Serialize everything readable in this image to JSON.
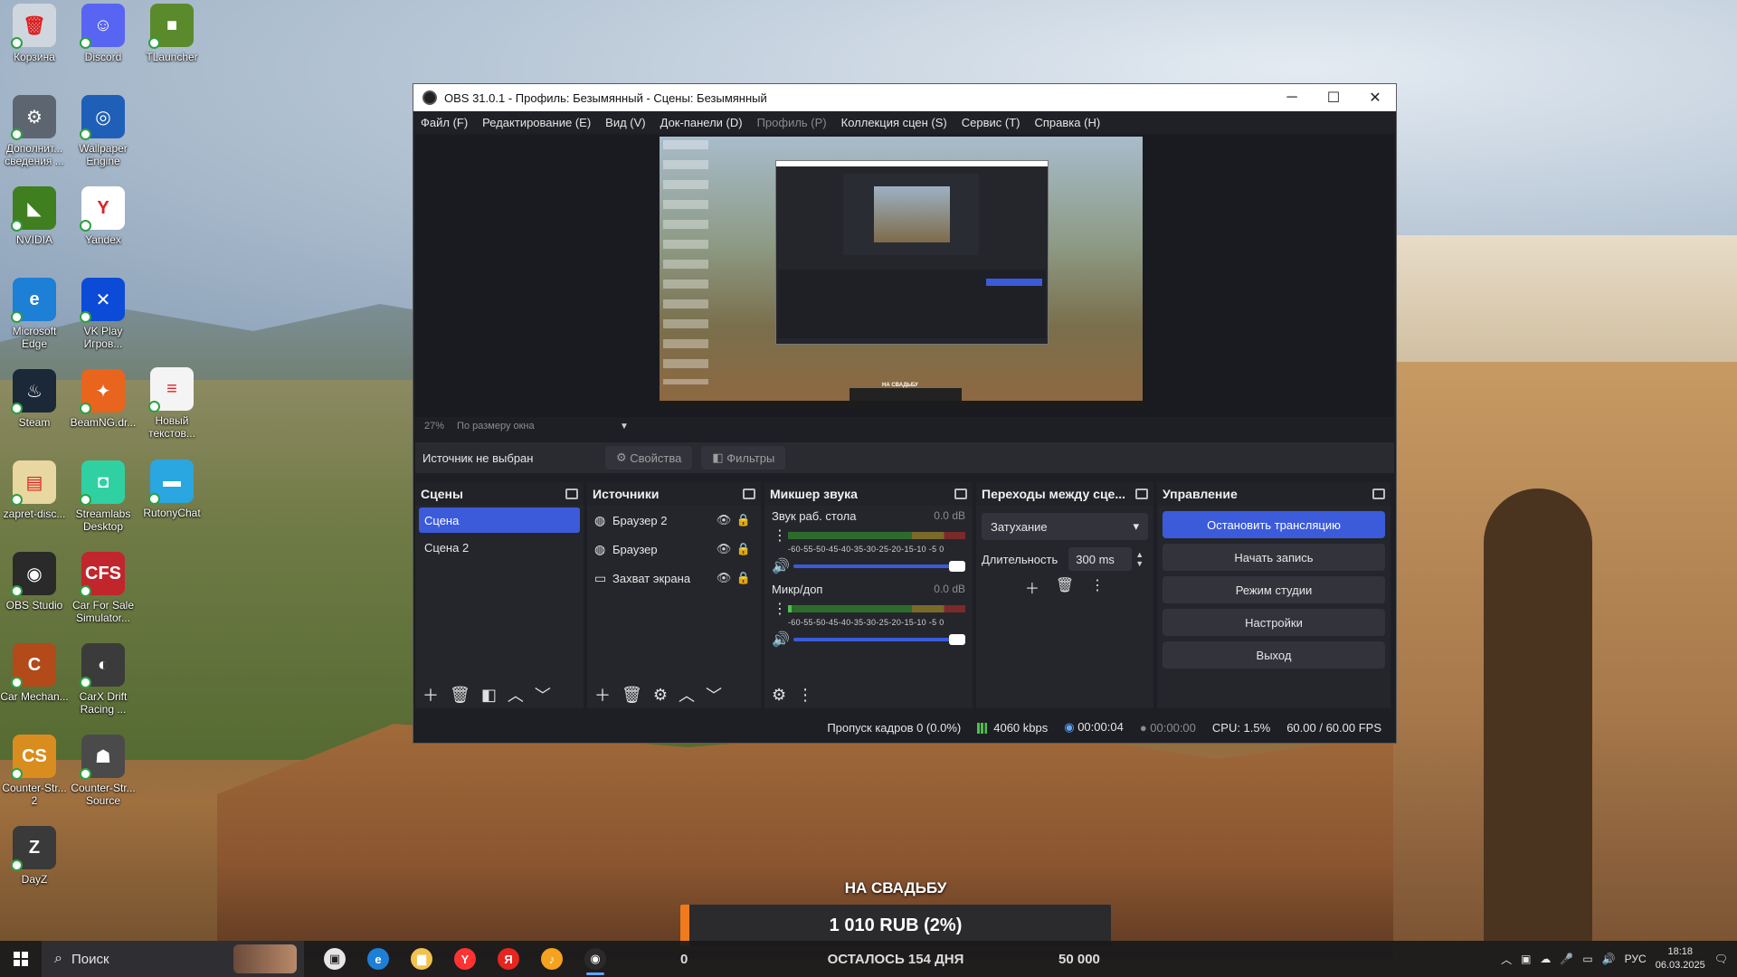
{
  "desktop": {
    "icons_col1": [
      {
        "label": "Корзина",
        "color": "#cfd6de",
        "glyph": "🗑"
      },
      {
        "label": "Дополнит... сведения ...",
        "color": "#5d6670",
        "glyph": "⚙"
      },
      {
        "label": "NVIDIA",
        "color": "#3f7f1f",
        "glyph": "◣"
      },
      {
        "label": "Microsoft Edge",
        "color": "#1d7fd6",
        "glyph": "e"
      },
      {
        "label": "Steam",
        "color": "#1b2838",
        "glyph": "♨"
      },
      {
        "label": "zapret-disc...",
        "color": "#e8d7a0",
        "glyph": "▤"
      },
      {
        "label": "OBS Studio",
        "color": "#2a2a2a",
        "glyph": "◉"
      },
      {
        "label": "Car Mechan...",
        "color": "#b24a1a",
        "glyph": "C"
      },
      {
        "label": "Counter-Str... 2",
        "color": "#d98d1e",
        "glyph": "CS"
      },
      {
        "label": "DayZ",
        "color": "#3a3a3a",
        "glyph": "Z"
      }
    ],
    "icons_col2": [
      {
        "label": "Discord",
        "color": "#5865f2",
        "glyph": "☺"
      },
      {
        "label": "Wallpaper Engine",
        "color": "#1f5fb8",
        "glyph": "◎"
      },
      {
        "label": "Yandex",
        "color": "#ffffff",
        "glyph": "Y"
      },
      {
        "label": "VK Play Игров...",
        "color": "#0b4bd8",
        "glyph": "✕"
      },
      {
        "label": "BeamNG.dr...",
        "color": "#e9641c",
        "glyph": "✦"
      },
      {
        "label": "Streamlabs Desktop",
        "color": "#2fd1a3",
        "glyph": "◘"
      },
      {
        "label": "Car For Sale Simulator...",
        "color": "#c0262b",
        "glyph": "CFS"
      },
      {
        "label": "CarX Drift Racing ...",
        "color": "#3b3b3b",
        "glyph": "◐"
      },
      {
        "label": "Counter-Str... Source",
        "color": "#4a4a4a",
        "glyph": "☗"
      }
    ],
    "icons_col3": [
      {
        "label": "TLauncher",
        "color": "#5a8a2b",
        "glyph": "■"
      },
      {
        "label": "Новый текстов...",
        "color": "#f4f4f4",
        "glyph": "≡"
      },
      {
        "label": "RutonyChat",
        "color": "#2aa6e0",
        "glyph": "▬"
      }
    ]
  },
  "obs": {
    "title": "OBS 31.0.1 - Профиль: Безымянный - Сцены: Безымянный",
    "menu": [
      "Файл (F)",
      "Редактирование (E)",
      "Вид (V)",
      "Док-панели (D)",
      "Профиль (P)",
      "Коллекция сцен (S)",
      "Сервис (T)",
      "Справка (H)"
    ],
    "preview_overlay_text": "НА СВАДЬБУ",
    "zoom": "27%",
    "zoom_mode": "По размеру окна",
    "source_bar": {
      "none_selected": "Источник не выбран",
      "properties": "Свойства",
      "filters": "Фильтры"
    },
    "scenes": {
      "title": "Сцены",
      "items": [
        "Сцена",
        "Сцена 2"
      ],
      "selected_index": 0
    },
    "sources": {
      "title": "Источники",
      "items": [
        {
          "name": "Браузер 2",
          "icon": "globe-icon"
        },
        {
          "name": "Браузер",
          "icon": "globe-icon"
        },
        {
          "name": "Захват экрана",
          "icon": "monitor-icon"
        }
      ]
    },
    "mixer": {
      "title": "Микшер звука",
      "channels": [
        {
          "name": "Звук раб. стола",
          "db": "0.0 dB",
          "level": 0.0
        },
        {
          "name": "Микр/доп",
          "db": "0.0 dB",
          "level": 0.02
        }
      ],
      "scale": "-60-55-50-45-40-35-30-25-20-15-10 -5  0"
    },
    "transitions": {
      "title": "Переходы между сце...",
      "selected": "Затухание",
      "duration_label": "Длительность",
      "duration_value": "300 ms"
    },
    "controls": {
      "title": "Управление",
      "stop_stream": "Остановить трансляцию",
      "start_record": "Начать запись",
      "studio_mode": "Режим студии",
      "settings": "Настройки",
      "exit": "Выход"
    },
    "status": {
      "dropped": "Пропуск кадров 0 (0.0%)",
      "bitrate": "4060 kbps",
      "stream_time": "00:00:04",
      "record_time": "00:00:00",
      "cpu": "CPU: 1.5%",
      "fps": "60.00 / 60.00 FPS"
    }
  },
  "donation": {
    "title": "НА СВАДЬБУ",
    "amount": "1 010 RUB (2%)",
    "progress": 0.02,
    "min": "0",
    "remaining": "ОСТАЛОСЬ 154 ДНЯ",
    "max": "50 000"
  },
  "taskbar": {
    "search": "Поиск",
    "apps": [
      {
        "name": "task-view",
        "glyph": "▣",
        "color": "#e6e6e6"
      },
      {
        "name": "edge",
        "glyph": "e",
        "color": "#1d7fd6"
      },
      {
        "name": "explorer",
        "glyph": "▆",
        "color": "#f2c14e"
      },
      {
        "name": "yandex-browser",
        "glyph": "Y",
        "color": "#ff3333"
      },
      {
        "name": "yandex",
        "glyph": "Я",
        "color": "#e52620"
      },
      {
        "name": "yandex-music",
        "glyph": "♪",
        "color": "#f6a21e"
      },
      {
        "name": "obs",
        "glyph": "◉",
        "color": "#2a2a2a"
      }
    ],
    "lang": "РУС",
    "time": "18:18",
    "date": "06.03.2025"
  }
}
